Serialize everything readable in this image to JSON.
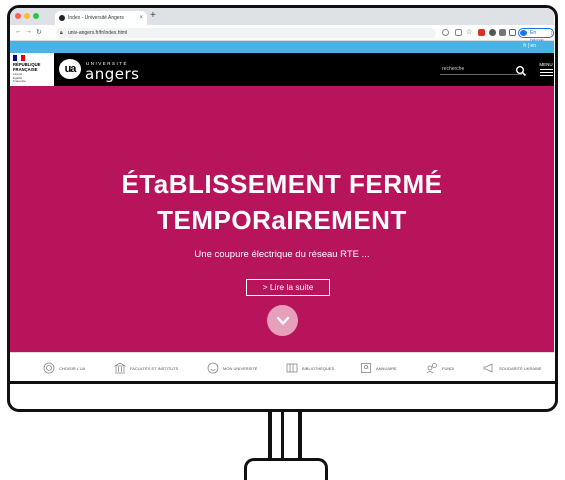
{
  "browser": {
    "tab_title": "Index - Université Angers",
    "tab_close": "×",
    "new_tab": "+",
    "url": "univ-angers.fr/fr/index.html",
    "profile_status": "En pause"
  },
  "site": {
    "language_links": "fr | en",
    "gov_logo": {
      "republic": "RÉPUBLIQUE\nFRANÇAISE",
      "motto": "Liberté\nÉgalité\nFraternité"
    },
    "logo": {
      "mark": "ua",
      "small": "UNIVERSITÉ",
      "name": "angers"
    },
    "search": {
      "placeholder": "recherche"
    },
    "menu_label": "MENU",
    "hero": {
      "title_line1": "ÉTaBLISSEMENT FERMÉ",
      "title_line2": "TEMPORaIREMENT",
      "subtitle": "Une coupure électrique du réseau RTE ...",
      "read_more": "> Lire la suite"
    },
    "quick_nav": [
      {
        "label": "Choisir l'UA",
        "icon": "target-icon"
      },
      {
        "label": "Facultés et instituts",
        "icon": "building-icon"
      },
      {
        "label": "Mon université",
        "icon": "smiley-icon"
      },
      {
        "label": "Bibliothèques",
        "icon": "books-icon"
      },
      {
        "label": "Annuaire",
        "icon": "directory-icon"
      },
      {
        "label": "Fundi",
        "icon": "people-icon"
      },
      {
        "label": "Solidarité Ukraine",
        "icon": "megaphone-icon"
      }
    ]
  },
  "colors": {
    "hero_bg": "#b8145c",
    "header_bg": "#000000",
    "langbar_bg": "#4ab3e3",
    "scroll_button": "#e7a0bb"
  }
}
